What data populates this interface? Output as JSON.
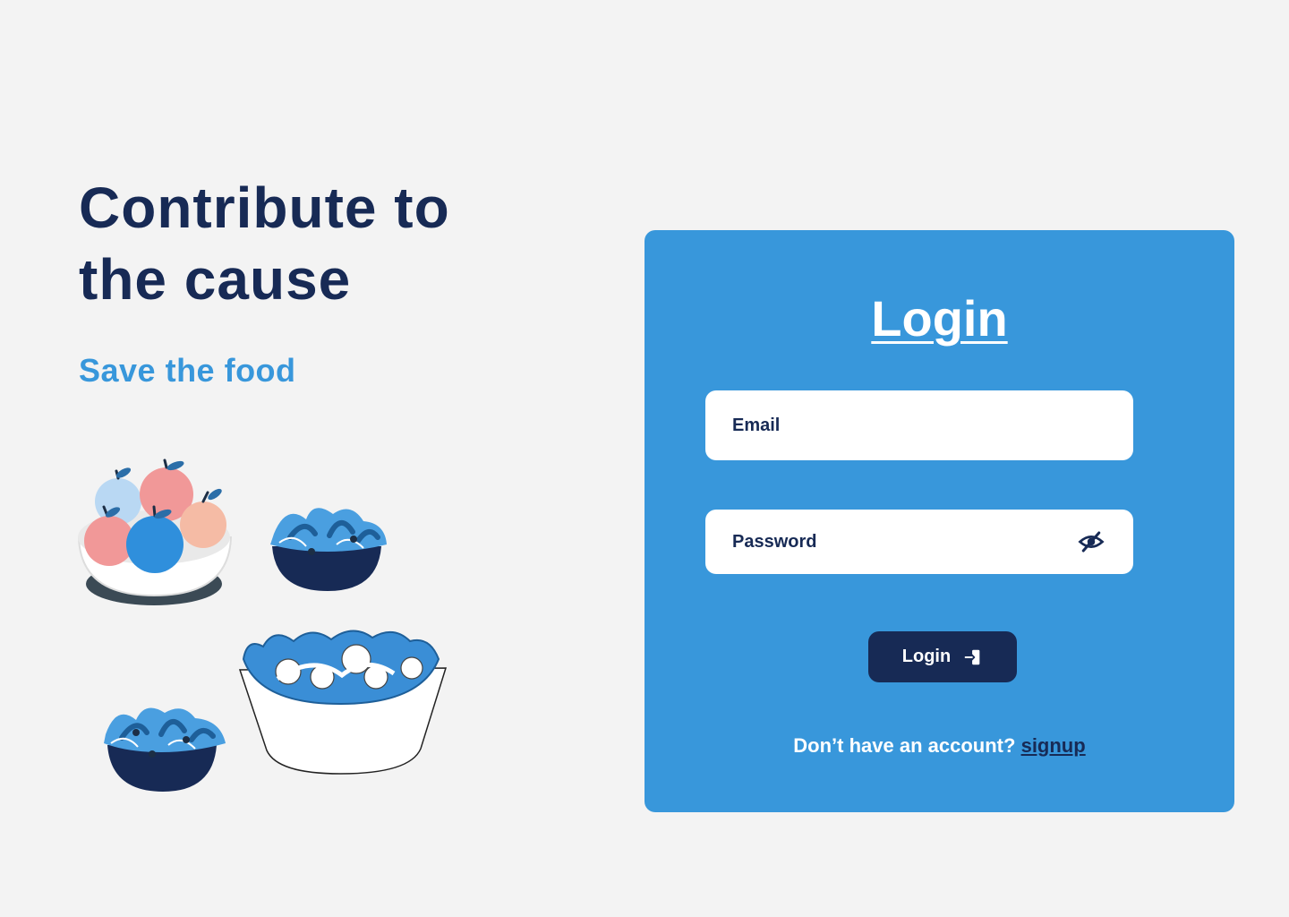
{
  "hero": {
    "headline_line1": "Contribute to",
    "headline_line2": "the cause",
    "tagline": "Save the food",
    "illustration_icon": "food-bowls-illustration"
  },
  "login": {
    "title": "Login",
    "email_placeholder": "Email",
    "password_placeholder": "Password",
    "password_toggle_icon": "eye-off-icon",
    "button_label": "Login",
    "button_icon": "login-icon",
    "signup_prompt": "Don’t have an account?",
    "signup_link": "signup"
  },
  "colors": {
    "background": "#f3f3f3",
    "navy": "#172a55",
    "accent_blue": "#3897db",
    "white": "#ffffff"
  }
}
